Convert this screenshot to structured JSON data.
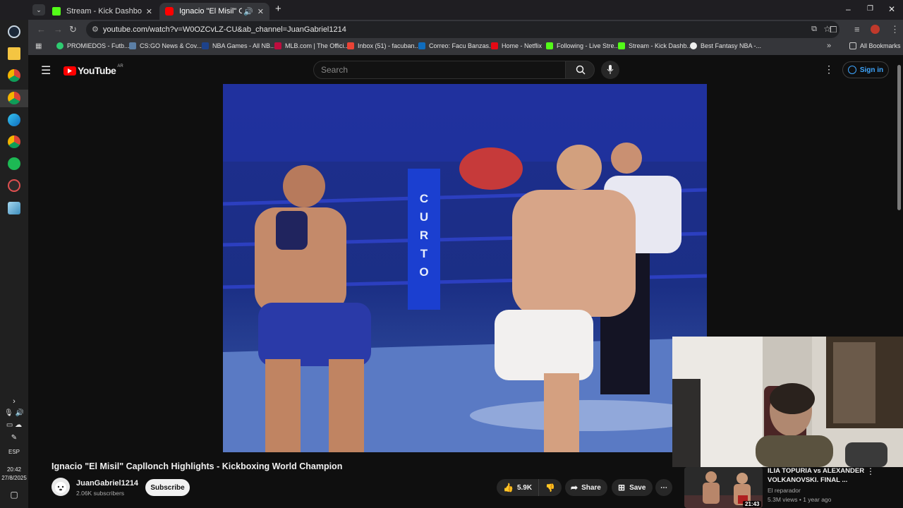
{
  "browser": {
    "tabs": [
      {
        "label": "Stream - Kick Dashboard",
        "active": false
      },
      {
        "label": "Ignacio \"El Misil\" Capllonch",
        "active": true
      }
    ],
    "url": "youtube.com/watch?v=W0OZCvLZ-CU&ab_channel=JuanGabriel1214",
    "bookmarks": [
      "PROMIEDOS - Futb...",
      "CS:GO News & Cov...",
      "NBA Games - All NB...",
      "MLB.com | The Offici...",
      "Inbox (51) - facuban...",
      "Correo: Facu Banzas...",
      "Home - Netflix",
      "Following - Live Stre...",
      "Stream - Kick Dashb...",
      "Best Fantasy NBA -..."
    ],
    "all_bookmarks": "All Bookmarks"
  },
  "taskbar": {
    "lang": "ESP",
    "time": "20:42",
    "date": "27/8/2025"
  },
  "youtube": {
    "logo": "YouTube",
    "region": "AR",
    "search_placeholder": "Search",
    "sign_in": "Sign in"
  },
  "video": {
    "title": "Ignacio \"El Misil\" Capllonch Highlights - Kickboxing World Champion",
    "channel": "JuanGabriel1214",
    "subscribers": "2.06K subscribers",
    "subscribe_label": "Subscribe",
    "likes": "5.9K",
    "share_label": "Share",
    "save_label": "Save",
    "banner_text": "CURTO"
  },
  "recommended": {
    "title": "ILIA TOPURIA vs ALEXANDER VOLKANOVSKI. FINAL ...",
    "channel": "El reparador",
    "meta": "5.3M views • 1 year ago",
    "duration": "21:43"
  },
  "colors": {
    "yt_red": "#ff0000",
    "kick_green": "#53fc18",
    "link_blue": "#3ea6ff"
  }
}
